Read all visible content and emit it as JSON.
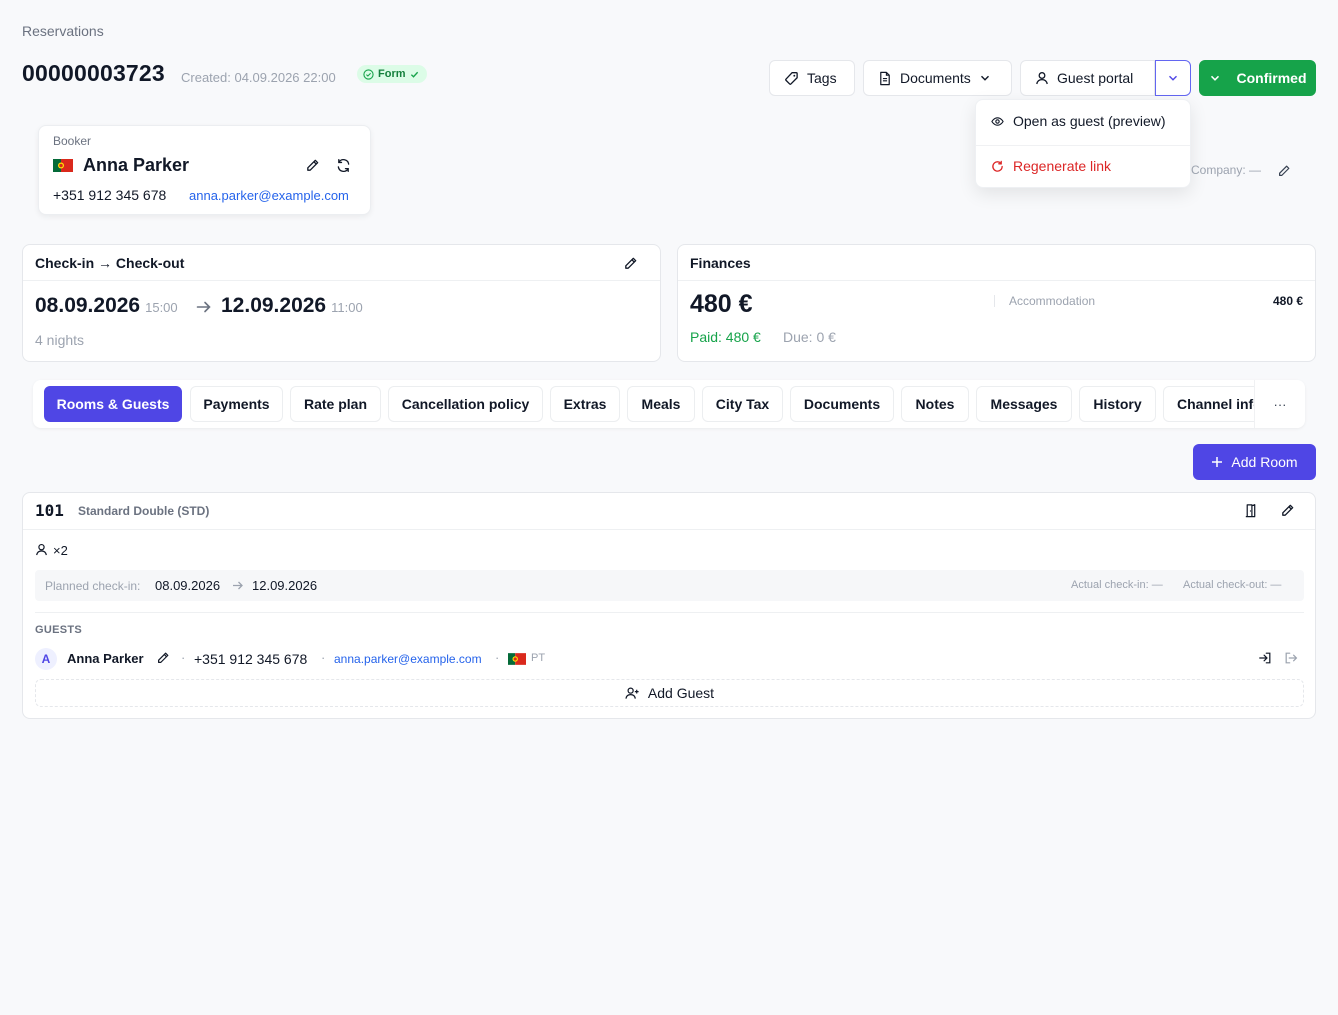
{
  "breadcrumb": "Reservations",
  "reservation": {
    "number": "00000003723",
    "created": "Created: 04.09.2026 22:00",
    "form_badge": "Form"
  },
  "toolbar": {
    "tags": "Tags",
    "documents": "Documents",
    "guest_portal": "Guest portal",
    "status": "Confirmed"
  },
  "guest_portal_menu": {
    "open_preview": "Open as guest (preview)",
    "regenerate": "Regenerate link"
  },
  "booker": {
    "label": "Booker",
    "name": "Anna Parker",
    "phone": "+351 912 345 678",
    "email": "anna.parker@example.com"
  },
  "company": "Company: —",
  "stay": {
    "header": "Check-in → Check-out",
    "checkin_date": "08.09.2026",
    "checkin_time": "15:00",
    "checkout_date": "12.09.2026",
    "checkout_time": "11:00",
    "nights": "4 nights"
  },
  "finances": {
    "header": "Finances",
    "total": "480 €",
    "paid": "Paid: 480 €",
    "due": "Due: 0 €",
    "line_label": "Accommodation",
    "line_value": "480 €"
  },
  "tabs": [
    "Rooms & Guests",
    "Payments",
    "Rate plan",
    "Cancellation policy",
    "Extras",
    "Meals",
    "City Tax",
    "Documents",
    "Notes",
    "Messages",
    "History",
    "Channel info"
  ],
  "tabs_more": "···",
  "add_room": "Add Room",
  "room": {
    "number": "101",
    "type": "Standard Double (STD)",
    "occupancy": "×2",
    "planned_label": "Planned check-in:",
    "planned_from": "08.09.2026",
    "planned_to": "12.09.2026",
    "actual_checkin": "Actual check-in: —",
    "actual_checkout": "Actual check-out: —",
    "guests_header": "GUESTS",
    "guest": {
      "initial": "A",
      "name": "Anna Parker",
      "phone": "+351 912 345 678",
      "email": "anna.parker@example.com",
      "country": "PT"
    },
    "add_guest": "Add Guest"
  },
  "colors": {
    "primary": "#4f46e5",
    "success": "#16a34a",
    "danger": "#dc2626",
    "link": "#2563eb"
  }
}
